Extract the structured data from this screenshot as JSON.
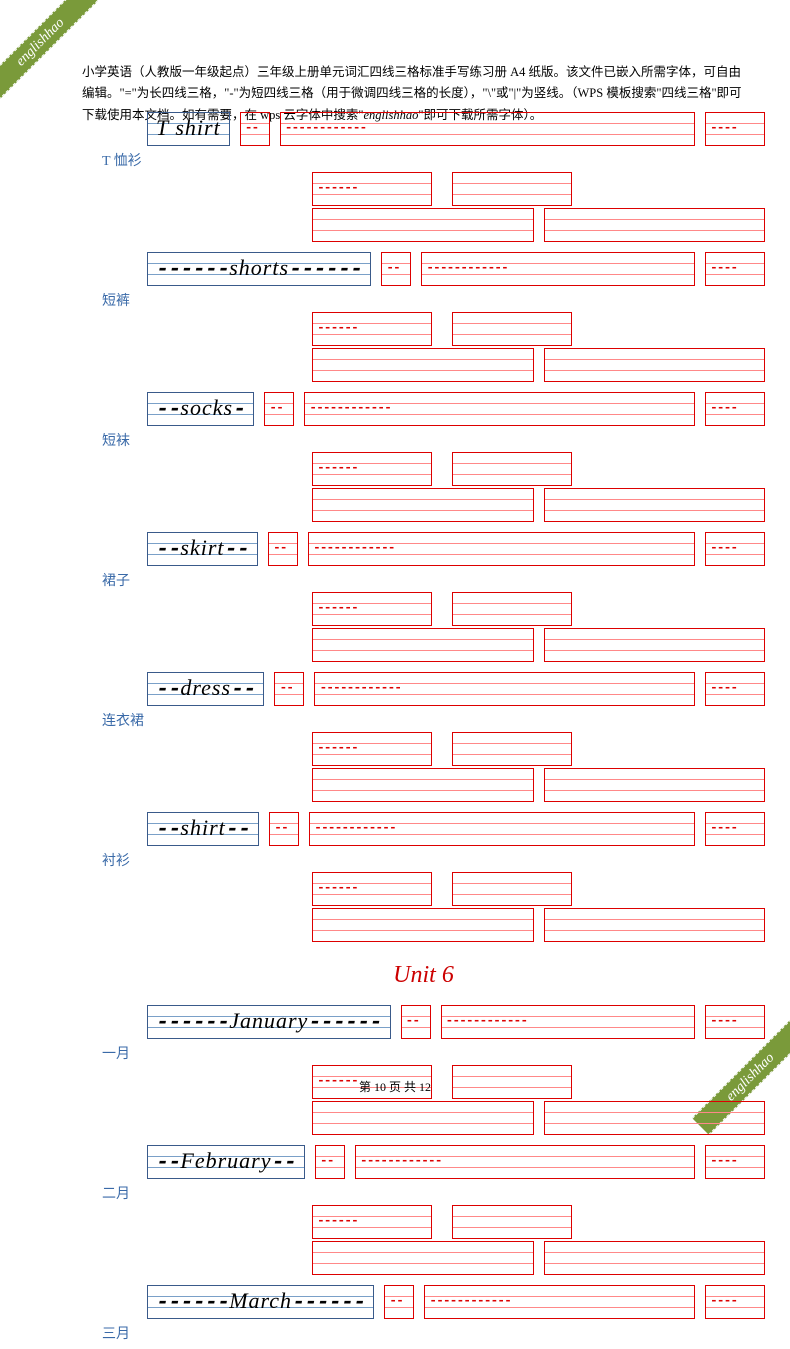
{
  "watermark": "englishhao",
  "header": "小学英语（人教版一年级起点）三年级上册单元词汇四线三格标准手写练习册 A4 纸版。该文件已嵌入所需字体，可自由编辑。\"=\"为长四线三格，\"-\"为短四线三格（用于微调四线三格的长度），\"\\\"或\"|\"为竖线。（WPS 模板搜索\"四线三格\"即可下载使用本文档。如有需要，在 wps 云字体中搜索\"",
  "header_italic": "englishhao",
  "header_end": "\"即可下载所需字体）。",
  "entries": [
    {
      "word": "T shirt",
      "cn": "T 恤衫",
      "pre": "",
      "post": ""
    },
    {
      "word": "shorts",
      "cn": "短裤",
      "pre": "------",
      "post": "------"
    },
    {
      "word": "socks",
      "cn": "短袜",
      "pre": "--",
      "post": "-"
    },
    {
      "word": "skirt",
      "cn": "裙子",
      "pre": "--",
      "post": "--"
    },
    {
      "word": "dress",
      "cn": "连衣裙",
      "pre": "--",
      "post": "--"
    },
    {
      "word": "shirt",
      "cn": "衬衫",
      "pre": "--",
      "post": "--"
    }
  ],
  "unit_title": "Unit 6",
  "entries2": [
    {
      "word": "January",
      "cn": "一月",
      "pre": "------",
      "post": "------"
    },
    {
      "word": "February",
      "cn": "二月",
      "pre": "--",
      "post": "--"
    },
    {
      "word": "March",
      "cn": "三月",
      "pre": "------",
      "post": "------"
    }
  ],
  "footer": {
    "pre": "第 ",
    "page": "10",
    "mid": " 页 共 ",
    "total": "12"
  }
}
